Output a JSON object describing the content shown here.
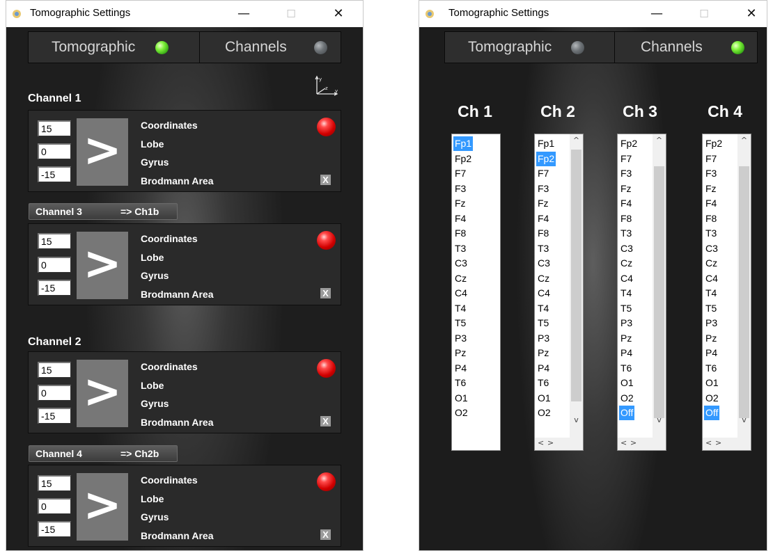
{
  "colors": {
    "led_green": "#5ddc2a",
    "led_grey": "#6c7175",
    "led_red": "#e00000",
    "selection": "#3399ff"
  },
  "left_window": {
    "title": "Tomographic Settings",
    "controls": {
      "minimize": "—",
      "maximize": "☐",
      "close": "✕"
    },
    "tabs": [
      {
        "label": "Tomographic",
        "led": "green"
      },
      {
        "label": "Channels",
        "led": "grey"
      }
    ],
    "axes_icon": "axes-xyz-icon",
    "channel_1": {
      "heading": "Channel 1",
      "values": [
        "15",
        "0",
        "-15"
      ],
      "go": ">",
      "labels": [
        "Coordinates",
        "Lobe",
        "Gyrus",
        "Brodmann Area"
      ],
      "x_label": "X"
    },
    "channel_3": {
      "button": "Channel 3",
      "target": "=> Ch1b",
      "values": [
        "15",
        "0",
        "-15"
      ],
      "go": ">",
      "labels": [
        "Coordinates",
        "Lobe",
        "Gyrus",
        "Brodmann Area"
      ],
      "x_label": "X"
    },
    "channel_2": {
      "heading": "Channel 2",
      "values": [
        "15",
        "0",
        "-15"
      ],
      "go": ">",
      "labels": [
        "Coordinates",
        "Lobe",
        "Gyrus",
        "Brodmann Area"
      ],
      "x_label": "X"
    },
    "channel_4": {
      "button": "Channel 4",
      "target": "=> Ch2b",
      "values": [
        "15",
        "0",
        "-15"
      ],
      "go": ">",
      "labels": [
        "Coordinates",
        "Lobe",
        "Gyrus",
        "Brodmann Area"
      ],
      "x_label": "X"
    }
  },
  "right_window": {
    "title": "Tomographic Settings",
    "controls": {
      "minimize": "—",
      "maximize": "☐",
      "close": "✕"
    },
    "tabs": [
      {
        "label": "Tomographic",
        "led": "grey"
      },
      {
        "label": "Channels",
        "led": "green"
      }
    ],
    "columns": [
      {
        "header": "Ch 1",
        "items": [
          "Fp1",
          "Fp2",
          "F7",
          "F3",
          "Fz",
          "F4",
          "F8",
          "T3",
          "C3",
          "Cz",
          "C4",
          "T4",
          "T5",
          "P3",
          "Pz",
          "P4",
          "T6",
          "O1",
          "O2"
        ],
        "selected": "Fp1"
      },
      {
        "header": "Ch 2",
        "items": [
          "Fp1",
          "Fp2",
          "F7",
          "F3",
          "Fz",
          "F4",
          "F8",
          "T3",
          "C3",
          "Cz",
          "C4",
          "T4",
          "T5",
          "P3",
          "Pz",
          "P4",
          "T6",
          "O1",
          "O2"
        ],
        "selected": "Fp2"
      },
      {
        "header": "Ch 3",
        "items": [
          "Fp2",
          "F7",
          "F3",
          "Fz",
          "F4",
          "F8",
          "T3",
          "C3",
          "Cz",
          "C4",
          "T4",
          "T5",
          "P3",
          "Pz",
          "P4",
          "T6",
          "O1",
          "O2",
          "Off"
        ],
        "selected": "Off"
      },
      {
        "header": "Ch 4",
        "items": [
          "Fp2",
          "F7",
          "F3",
          "Fz",
          "F4",
          "F8",
          "T3",
          "C3",
          "Cz",
          "C4",
          "T4",
          "T5",
          "P3",
          "Pz",
          "P4",
          "T6",
          "O1",
          "O2",
          "Off"
        ],
        "selected": "Off"
      }
    ],
    "scroll_glyphs": {
      "up": "^",
      "down": "v",
      "left": "<",
      "right": ">"
    }
  }
}
